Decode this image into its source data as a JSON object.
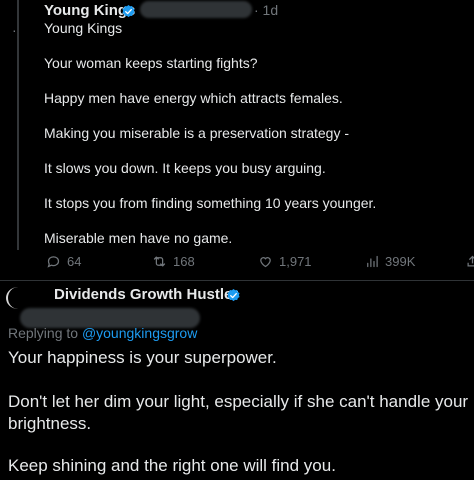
{
  "colors": {
    "background": "#000000",
    "text": "#e7e9ea",
    "muted": "#71767b",
    "link": "#1d9bf0",
    "verified": "#1d9bf0"
  },
  "top_tweet": {
    "display_name": "Young Kings",
    "handle": "Young Kings",
    "dot": "·",
    "time": "· 1d",
    "lines": [
      "Your woman keeps starting fights?",
      "Happy men have energy which attracts females.",
      "Making you miserable is a preservation strategy -",
      "It slows you down. It keeps you busy arguing.",
      "It stops you from finding something 10 years younger.",
      "Miserable men have no game."
    ],
    "actions": {
      "replies": "64",
      "retweets": "168",
      "likes": "1,971",
      "views": "399K"
    },
    "icons": [
      "verified-badge-icon",
      "reply-icon",
      "retweet-icon",
      "like-icon",
      "views-icon",
      "share-icon"
    ]
  },
  "reply_tweet": {
    "display_name": "Dividends Growth Hustler",
    "replying_prefix": "Replying to ",
    "replying_handle": "@youngkingsgrow",
    "lines": [
      "Your happiness is your superpower.",
      "Don't let her dim your light, especially if she can't handle your",
      "brightness.",
      "Keep shining and the right one will find you."
    ]
  }
}
